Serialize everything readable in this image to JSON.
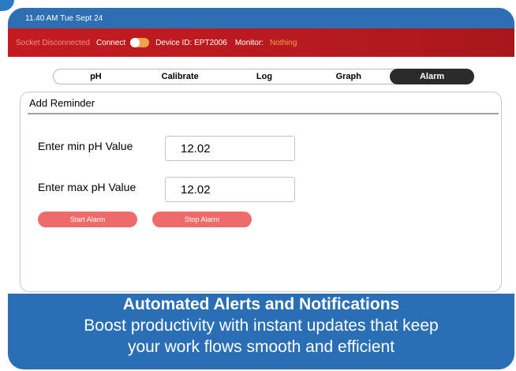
{
  "status_bar": {
    "time": "11.40 AM Tue Sept 24"
  },
  "header": {
    "socket_status": "Socket Disconnected",
    "connect_label": "Connect",
    "connect_toggle": "off",
    "device_id": "Device ID: EPT2006",
    "monitor_label": "Monitor:",
    "monitor_value": "Nothing"
  },
  "tabs": [
    {
      "label": "pH",
      "active": false
    },
    {
      "label": "Calibrate",
      "active": false
    },
    {
      "label": "Log",
      "active": false
    },
    {
      "label": "Graph",
      "active": false
    },
    {
      "label": "Alarm",
      "active": true
    }
  ],
  "panel": {
    "title": "Add Reminder",
    "min_label": "Enter min pH Value",
    "min_value": "12.02",
    "max_label": "Enter max pH Value",
    "max_value": "12.02",
    "start_button": "Start Alarm",
    "stop_button": "Stop Alarm"
  },
  "caption": {
    "title": "Automated Alerts and Notifications",
    "subtitle_line1": "Boost productivity with instant updates that keep",
    "subtitle_line2": "your work flows smooth and efficient"
  },
  "colors": {
    "frame_blue": "#2a6fb6",
    "header_red": "#c31b20",
    "button_red": "#ee6b6b",
    "toggle_orange": "#f0a24a",
    "active_tab": "#2b2b2b"
  }
}
